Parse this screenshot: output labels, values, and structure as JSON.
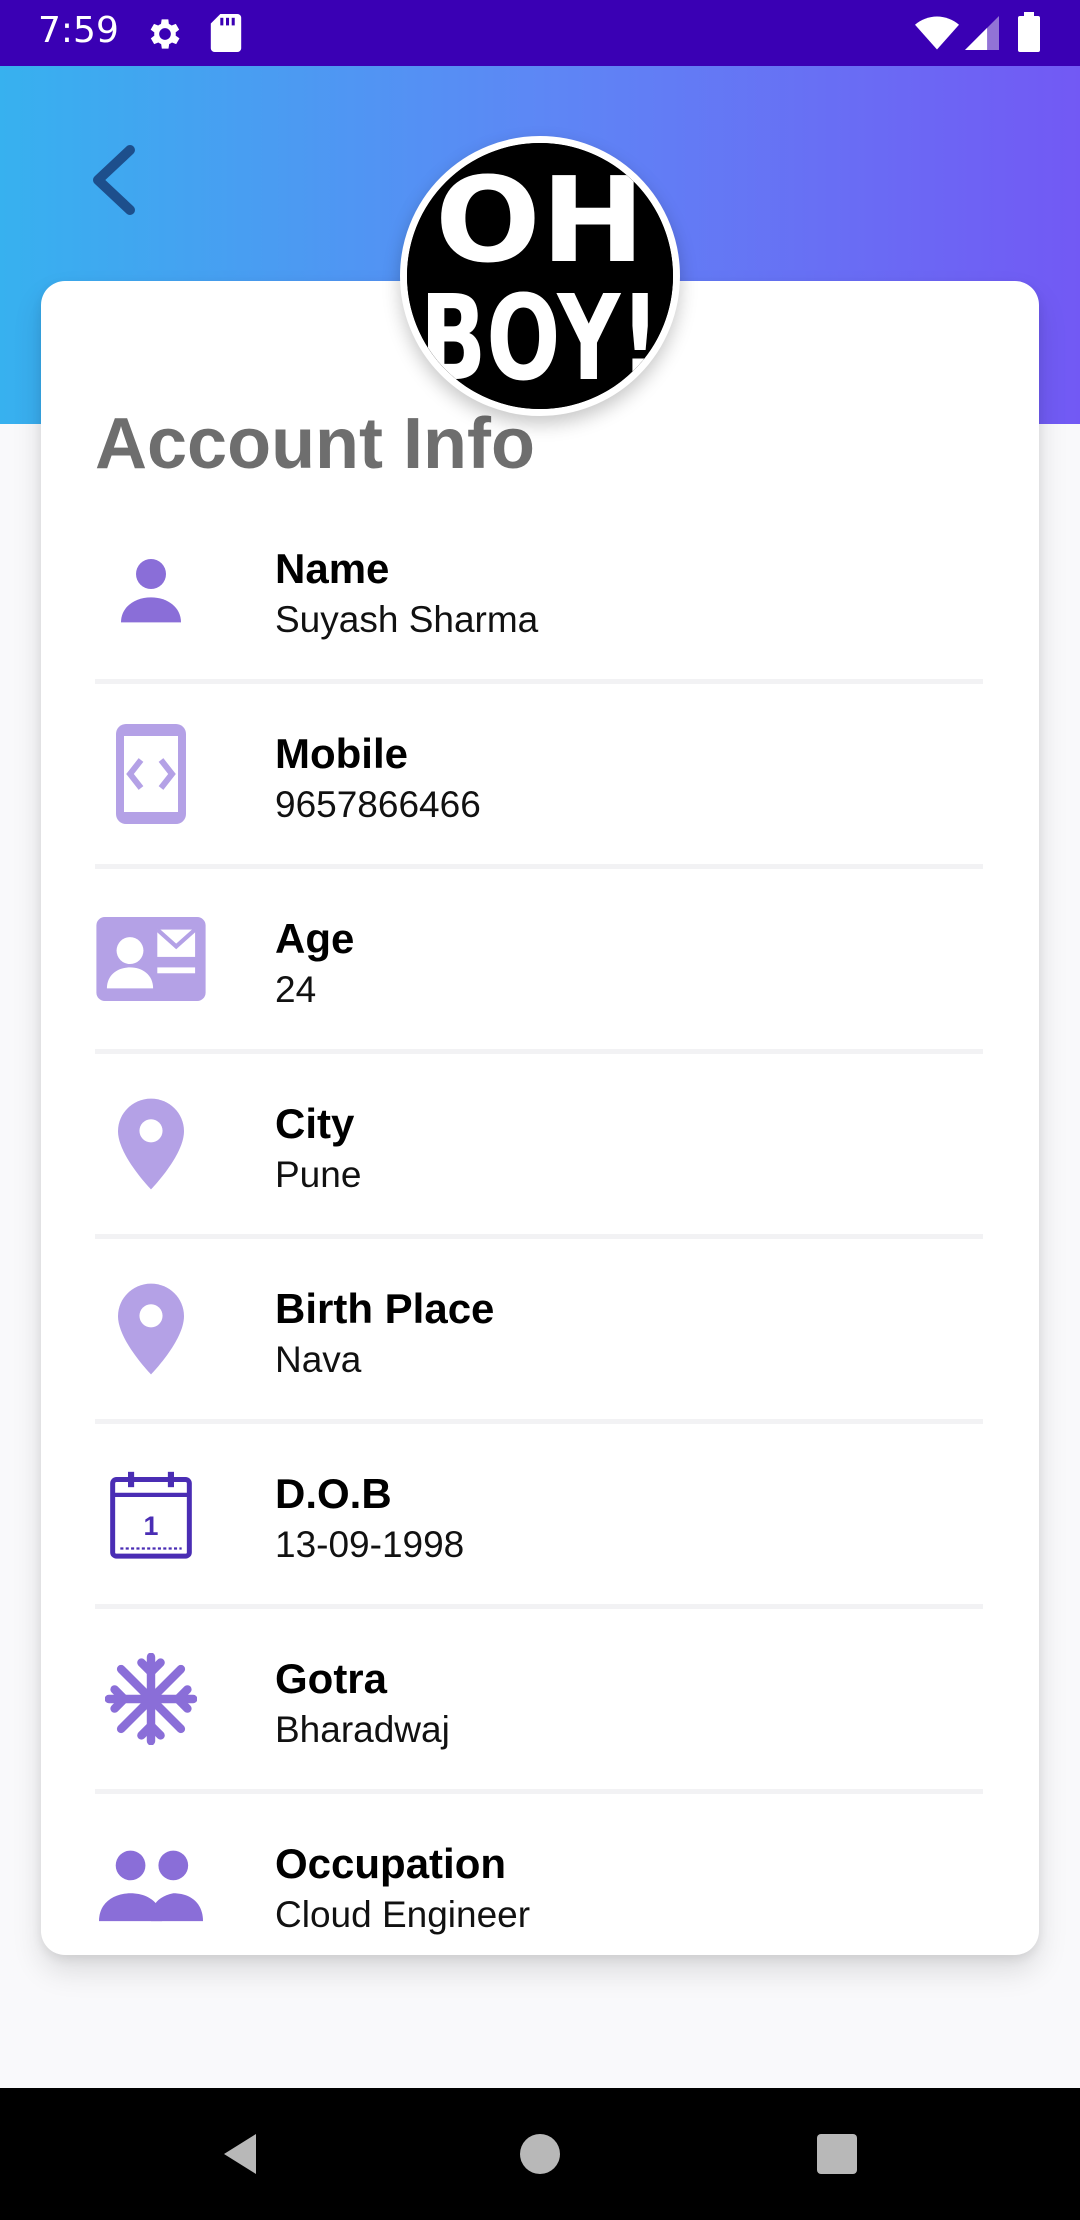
{
  "status_bar": {
    "time": "7:59",
    "icons": [
      "gear-icon",
      "sd-card-icon",
      "wifi-icon",
      "signal-icon",
      "battery-icon"
    ]
  },
  "header": {
    "back_icon": "chevron-left-icon",
    "avatar_text": "OH BOY!",
    "gradient": [
      "#37b1ef",
      "#7259f4"
    ]
  },
  "account": {
    "title": "Account Info",
    "fields": [
      {
        "icon": "person-icon",
        "label": "Name",
        "value": "Suyash Sharma"
      },
      {
        "icon": "mobile-icon",
        "label": "Mobile",
        "value": "9657866466"
      },
      {
        "icon": "id-card-icon",
        "label": "Age",
        "value": "24"
      },
      {
        "icon": "location-pin-icon",
        "label": "City",
        "value": "Pune"
      },
      {
        "icon": "location-pin-icon",
        "label": "Birth Place",
        "value": "Nava"
      },
      {
        "icon": "calendar-icon",
        "label": "D.O.B",
        "value": "13-09-1998"
      },
      {
        "icon": "snowflake-icon",
        "label": "Gotra",
        "value": "Bharadwaj"
      },
      {
        "icon": "group-icon",
        "label": "Occupation",
        "value": "Cloud Engineer"
      }
    ]
  },
  "colors": {
    "status_bar": "#3a00b4",
    "icon_purple": "#8a6ed8",
    "icon_light_purple": "#b4a1e6",
    "title_gray": "#6e6e6e"
  },
  "nav_bar": {
    "buttons": [
      "back-triangle-icon",
      "home-circle-icon",
      "recents-square-icon"
    ]
  }
}
